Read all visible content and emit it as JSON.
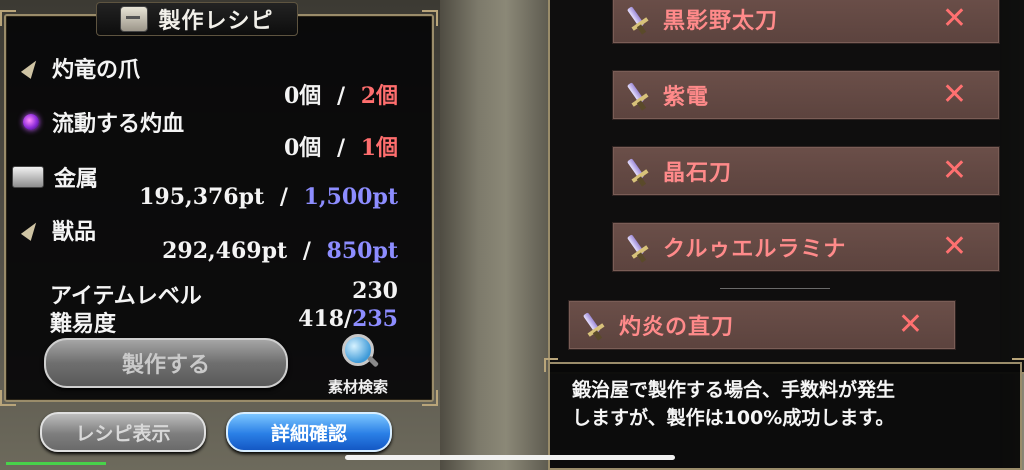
{
  "recipe_panel": {
    "title": "製作レシピ",
    "materials": [
      {
        "name": "灼竜の爪",
        "have": "0個",
        "sep": "/",
        "need": "2個",
        "icon": "claw-icon"
      },
      {
        "name": "流動する灼血",
        "have": "0個",
        "sep": "/",
        "need": "1個",
        "icon": "orb-icon"
      },
      {
        "name": "金属",
        "have": "195,376pt",
        "sep": "/",
        "need": "1,500pt",
        "icon": "metal-icon"
      },
      {
        "name": "獣品",
        "have": "292,469pt",
        "sep": "/",
        "need": "850pt",
        "icon": "claw-icon"
      }
    ],
    "item_level_label": "アイテムレベル",
    "item_level_value": "230",
    "difficulty_label": "難易度",
    "difficulty_current": "418/",
    "difficulty_max": "235",
    "craft_button": "製作する",
    "search_label": "素材検索"
  },
  "bottom_buttons": {
    "recipe_view": "レシピ表示",
    "detail_confirm": "詳細確認"
  },
  "weapon_list": [
    {
      "name": "黒影野太刀",
      "mark": "✕"
    },
    {
      "name": "紫電",
      "mark": "✕"
    },
    {
      "name": "晶石刀",
      "mark": "✕"
    },
    {
      "name": "クルゥエルラミナ",
      "mark": "✕"
    },
    {
      "name": "灼炎の直刀",
      "mark": "✕"
    }
  ],
  "message": {
    "line1": "鍛治屋で製作する場合、手数料が発生",
    "line2": "しますが、製作は100%成功します。"
  },
  "colors": {
    "requirement_short": "#ff6e6e",
    "requirement_met": "#8d8dff",
    "list_item_text": "#ff8a8a",
    "primary_button": "#2a7fe6"
  }
}
